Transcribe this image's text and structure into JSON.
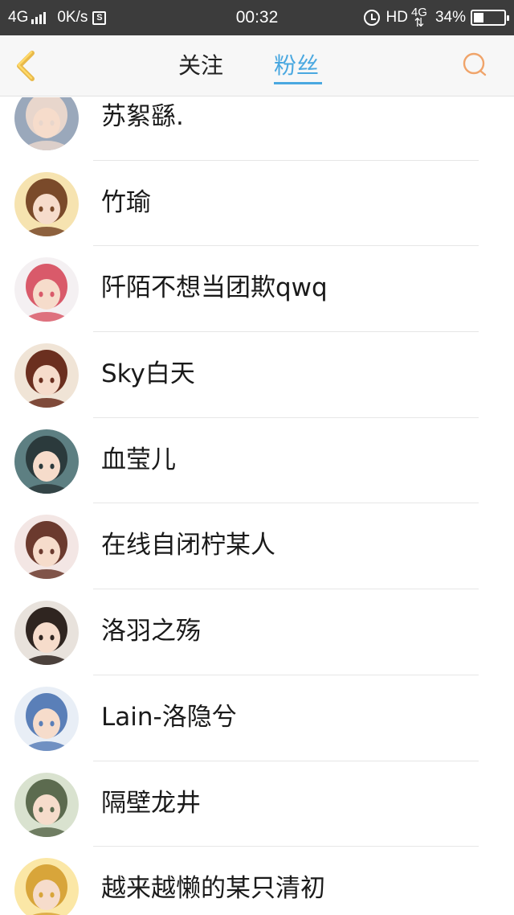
{
  "status_bar": {
    "network": "4G",
    "speed": "0K/s",
    "s_badge": "S",
    "time": "00:32",
    "hd": "HD",
    "network_right": "4G",
    "battery": "34%",
    "battery_level": 0.34
  },
  "header": {
    "tab_follow": "关注",
    "tab_fans": "粉丝",
    "active_tab": "粉丝",
    "accent_color": "#4aa8e0",
    "back_icon": "chevron-left-icon",
    "search_icon": "search-icon"
  },
  "fans": [
    {
      "name": "苏絮繇.",
      "avatar_colors": [
        "#9aa8bb",
        "#e8d6cc"
      ]
    },
    {
      "name": "竹瑜",
      "avatar_colors": [
        "#f6e3b0",
        "#7a4a2a"
      ]
    },
    {
      "name": "阡陌不想当团欺qwq",
      "avatar_colors": [
        "#f4f0f2",
        "#d95a6a"
      ]
    },
    {
      "name": "Sky白天",
      "avatar_colors": [
        "#f0e4d6",
        "#6b2f1f"
      ]
    },
    {
      "name": "血莹儿",
      "avatar_colors": [
        "#5d7f82",
        "#2b3a3c"
      ]
    },
    {
      "name": "在线自闭柠某人",
      "avatar_colors": [
        "#f3e6e4",
        "#6b3a2e"
      ]
    },
    {
      "name": "洛羽之殇",
      "avatar_colors": [
        "#e8e2dc",
        "#2f2520"
      ]
    },
    {
      "name": "Lain-洛隐兮",
      "avatar_colors": [
        "#e8eef6",
        "#5a7fb8"
      ]
    },
    {
      "name": "隔壁龙井",
      "avatar_colors": [
        "#d9e2cf",
        "#5c6b4f"
      ]
    },
    {
      "name": "越来越懒的某只清初",
      "avatar_colors": [
        "#fbe7a6",
        "#d8a53a"
      ]
    }
  ]
}
